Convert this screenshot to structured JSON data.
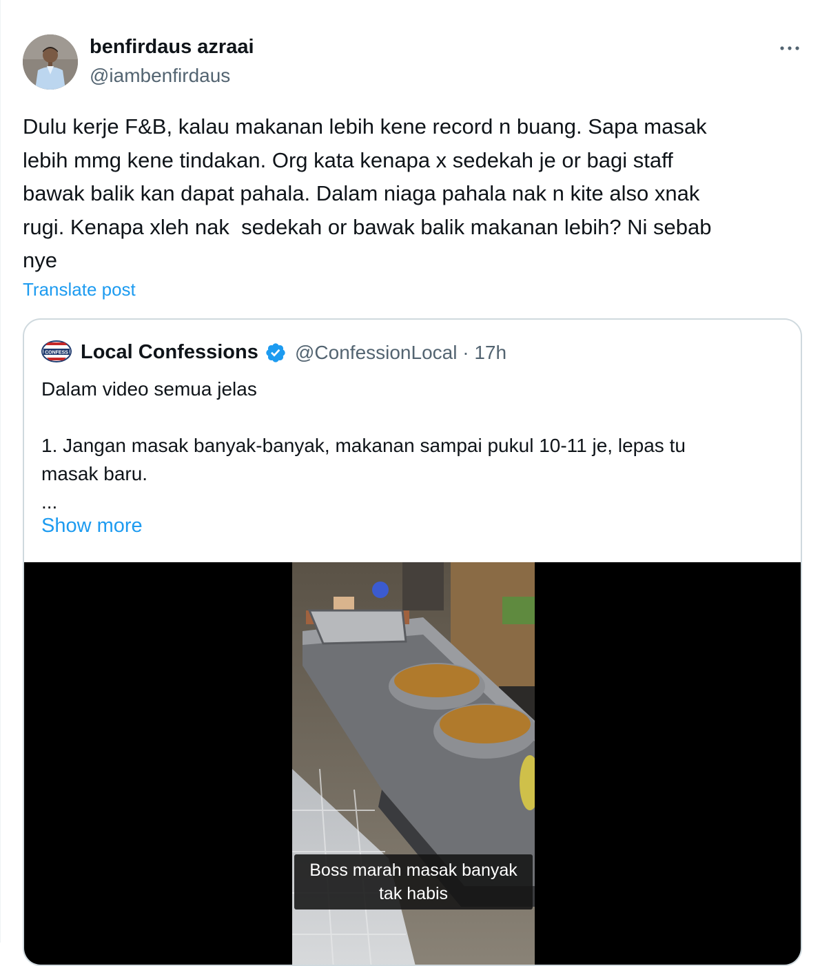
{
  "post": {
    "author_name": "benfirdaus azraai",
    "author_handle": "@iambenfirdaus",
    "text": "Dulu kerje F&B, kalau makanan lebih kene record n buang. Sapa masak\nlebih mmg kene tindakan. Org kata kenapa x sedekah je or bagi staff\nbawak balik kan dapat pahala. Dalam niaga pahala nak n kite also xnak\nrugi. Kenapa xleh nak  sedekah or bawak balik makanan lebih? Ni sebab\nnye",
    "translate_label": "Translate post",
    "more_icon": "more-horizontal-icon"
  },
  "quote": {
    "author_name": "Local Confessions",
    "handle_time": "@ConfessionLocal · 17h",
    "logo_text": "CONFESS",
    "text": "Dalam video semua jelas\n\n1. Jangan masak banyak-banyak, makanan sampai pukul 10-11 je, lepas tu\nmasak baru.\n...",
    "show_more_label": "Show more",
    "verified_icon": "verified-badge-icon",
    "verified_color": "#1d9bf0",
    "video_caption": "Boss marah masak banyak\ntak habis"
  },
  "colors": {
    "link": "#1d9bf0",
    "secondary_text": "#536471",
    "border": "#cfd9de"
  }
}
